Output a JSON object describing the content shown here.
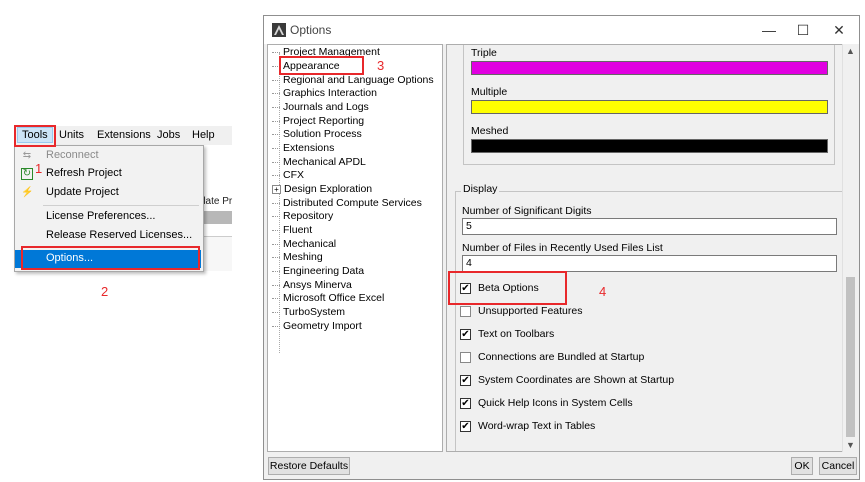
{
  "menubar": {
    "items": [
      {
        "label": "Tools"
      },
      {
        "label": "Units"
      },
      {
        "label": "Extensions"
      },
      {
        "label": "Jobs"
      },
      {
        "label": "Help"
      }
    ],
    "active_index": 0
  },
  "background_text": "date Pr",
  "tools_menu": {
    "items": [
      {
        "label": "Reconnect",
        "icon": "reconnect-icon",
        "disabled": true
      },
      {
        "label": "Refresh Project",
        "icon": "refresh-icon",
        "disabled": false
      },
      {
        "label": "Update Project",
        "icon": "lightning-icon",
        "disabled": false
      },
      {
        "label": "License Preferences...",
        "icon": "",
        "disabled": false
      },
      {
        "label": "Release Reserved Licenses...",
        "icon": "",
        "disabled": false
      },
      {
        "label": "Options...",
        "icon": "",
        "disabled": false,
        "selected": true
      }
    ]
  },
  "annotations": {
    "n1": "1",
    "n2": "2",
    "n3": "3",
    "n4": "4",
    "color": "#e8282b"
  },
  "dialog": {
    "title": "Options",
    "window_buttons": {
      "minimize": "—",
      "maximize": "☐",
      "close": "✕"
    },
    "tree": [
      {
        "label": "Project Management"
      },
      {
        "label": "Appearance",
        "selected": true
      },
      {
        "label": "Regional and Language Options"
      },
      {
        "label": "Graphics Interaction"
      },
      {
        "label": "Journals and Logs"
      },
      {
        "label": "Project Reporting"
      },
      {
        "label": "Solution Process"
      },
      {
        "label": "Extensions"
      },
      {
        "label": "Mechanical APDL"
      },
      {
        "label": "CFX"
      },
      {
        "label": "Design Exploration",
        "expandable": true
      },
      {
        "label": "Distributed Compute Services"
      },
      {
        "label": "Repository"
      },
      {
        "label": "Fluent"
      },
      {
        "label": "Mechanical"
      },
      {
        "label": "Meshing"
      },
      {
        "label": "Engineering Data"
      },
      {
        "label": "Ansys Minerva"
      },
      {
        "label": "Microsoft Office Excel"
      },
      {
        "label": "TurboSystem"
      },
      {
        "label": "Geometry Import"
      }
    ],
    "colors": [
      {
        "label": "Triple",
        "color": "#e100e1"
      },
      {
        "label": "Multiple",
        "color": "#ffff00"
      },
      {
        "label": "Meshed",
        "color": "#000000"
      }
    ],
    "display": {
      "title": "Display",
      "sig_digits_label": "Number of Significant Digits",
      "sig_digits_value": "5",
      "recent_files_label": "Number of Files in Recently Used Files List",
      "recent_files_value": "4",
      "checkboxes": [
        {
          "label": "Beta Options",
          "checked": true
        },
        {
          "label": "Unsupported Features",
          "checked": false
        },
        {
          "label": "Text on Toolbars",
          "checked": true
        },
        {
          "label": "Connections are Bundled at Startup",
          "checked": false
        },
        {
          "label": "System Coordinates are Shown at Startup",
          "checked": true
        },
        {
          "label": "Quick Help Icons in System Cells",
          "checked": true
        },
        {
          "label": "Word-wrap Text in Tables",
          "checked": true
        }
      ]
    },
    "buttons": {
      "restore": "Restore Defaults",
      "ok": "OK",
      "cancel": "Cancel"
    }
  }
}
